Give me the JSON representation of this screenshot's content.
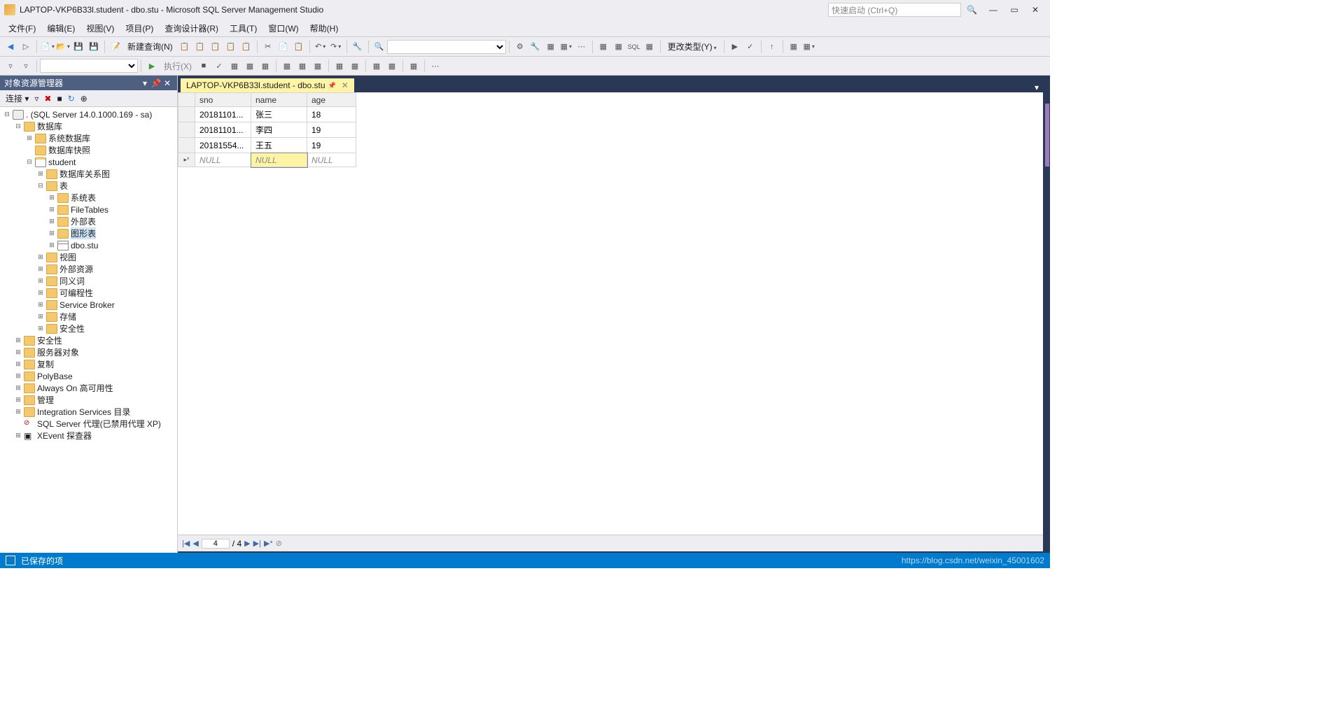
{
  "window": {
    "title": "LAPTOP-VKP6B33l.student - dbo.stu - Microsoft SQL Server Management Studio"
  },
  "quick_launch": {
    "placeholder": "快速启动 (Ctrl+Q)"
  },
  "menu": {
    "file": "文件(F)",
    "edit": "编辑(E)",
    "view": "视图(V)",
    "project": "项目(P)",
    "query": "查询设计器(R)",
    "tools": "工具(T)",
    "window": "窗口(W)",
    "help": "帮助(H)"
  },
  "toolbar": {
    "new_query": "新建查询(N)",
    "execute": "执行(X)",
    "change_type": "更改类型(Y)"
  },
  "explorer": {
    "title": "对象资源管理器",
    "connect": "连接",
    "root": ". (SQL Server 14.0.1000.169 - sa)",
    "nodes": {
      "databases": "数据库",
      "system_dbs": "系统数据库",
      "db_snapshots": "数据库快照",
      "student": "student",
      "db_diagrams": "数据库关系图",
      "tables": "表",
      "system_tables": "系统表",
      "filetables": "FileTables",
      "external_tables": "外部表",
      "graph_tables": "图形表",
      "dbo_stu": "dbo.stu",
      "views": "视图",
      "external_resources": "外部资源",
      "synonyms": "同义词",
      "programmability": "可编程性",
      "service_broker": "Service Broker",
      "storage": "存储",
      "security_db": "安全性",
      "security": "安全性",
      "server_objects": "服务器对象",
      "replication": "复制",
      "polybase": "PolyBase",
      "always_on": "Always On 高可用性",
      "management": "管理",
      "integration": "Integration Services 目录",
      "sql_agent": "SQL Server 代理(已禁用代理 XP)",
      "xevent": "XEvent 探查器"
    }
  },
  "tab": {
    "title": "LAPTOP-VKP6B33l.student - dbo.stu"
  },
  "grid": {
    "columns": [
      "sno",
      "name",
      "age"
    ],
    "rows": [
      {
        "sno": "20181101...",
        "name": "张三",
        "age": "18"
      },
      {
        "sno": "20181101...",
        "name": "李四",
        "age": "19"
      },
      {
        "sno": "20181554...",
        "name": "王五",
        "age": "19"
      }
    ],
    "null": "NULL"
  },
  "navigator": {
    "current": "4",
    "total": "/ 4"
  },
  "status": {
    "text": "已保存的项",
    "watermark": "https://blog.csdn.net/weixin_45001602"
  }
}
